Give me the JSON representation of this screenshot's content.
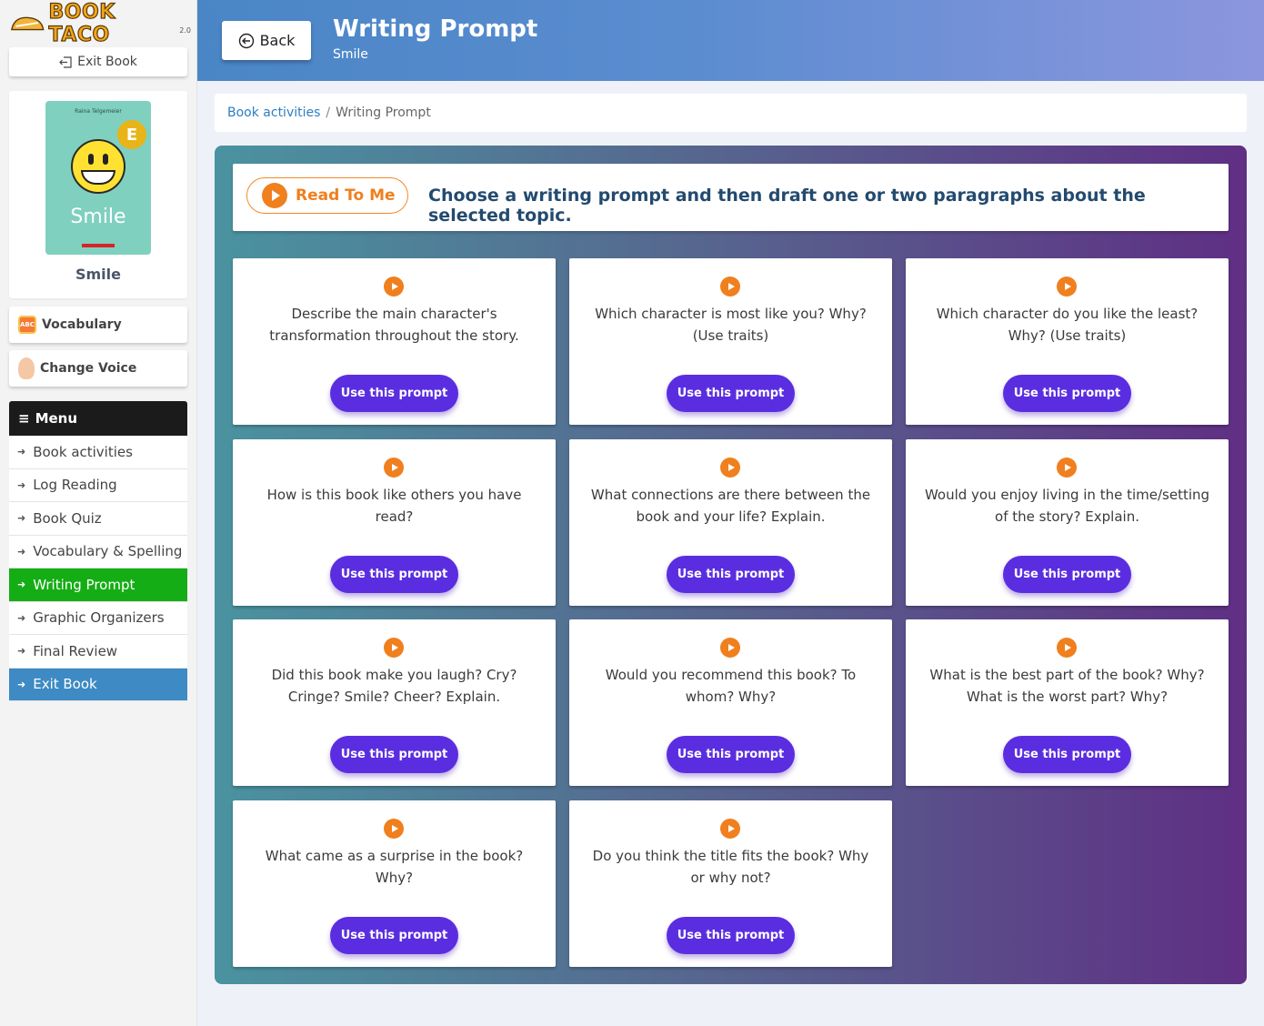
{
  "logo": {
    "text": "BOOK TACO",
    "suffix": "2.0"
  },
  "sidebar": {
    "exit_top": "Exit Book",
    "book": {
      "cover_author": "Raina Telgemeier",
      "cover_title": "Smile",
      "name": "Smile"
    },
    "vocabulary": "Vocabulary",
    "vocabulary_icon": "ABC",
    "change_voice": "Change Voice",
    "menu_label": "Menu",
    "menu_items": [
      {
        "label": "Book activities"
      },
      {
        "label": "Log Reading"
      },
      {
        "label": "Book Quiz"
      },
      {
        "label": "Vocabulary & Spelling"
      },
      {
        "label": "Writing Prompt"
      },
      {
        "label": "Graphic Organizers"
      },
      {
        "label": "Final Review"
      },
      {
        "label": "Exit Book"
      }
    ]
  },
  "header": {
    "back": "Back",
    "title": "Writing Prompt",
    "subtitle": "Smile"
  },
  "breadcrumb": {
    "link": "Book activities",
    "sep": "/",
    "current": "Writing Prompt"
  },
  "instructions": {
    "read_to_me": "Read To Me",
    "text": "Choose a writing prompt and then draft one or two paragraphs about the selected topic."
  },
  "use_label": "Use this prompt",
  "prompts": [
    "Describe the main character's transformation throughout the story.",
    "Which character is most like you? Why? (Use traits)",
    "Which character do you like the least? Why? (Use traits)",
    "How is this book like others you have read?",
    "What connections are there between the book and your life? Explain.",
    "Would you enjoy living in the time/setting of the story? Explain.",
    "Did this book make you laugh? Cry? Cringe? Smile? Cheer? Explain.",
    "Would you recommend this book? To whom? Why?",
    "What is the best part of the book? Why? What is the worst part? Why?",
    "What came as a surprise in the book? Why?",
    "Do you think the title fits the book? Why or why not?"
  ],
  "colors": {
    "active_menu": "#15ad15",
    "exit_menu": "#3d8ac4",
    "use_button": "#5a2ee0",
    "accent_orange": "#f07f1e"
  }
}
